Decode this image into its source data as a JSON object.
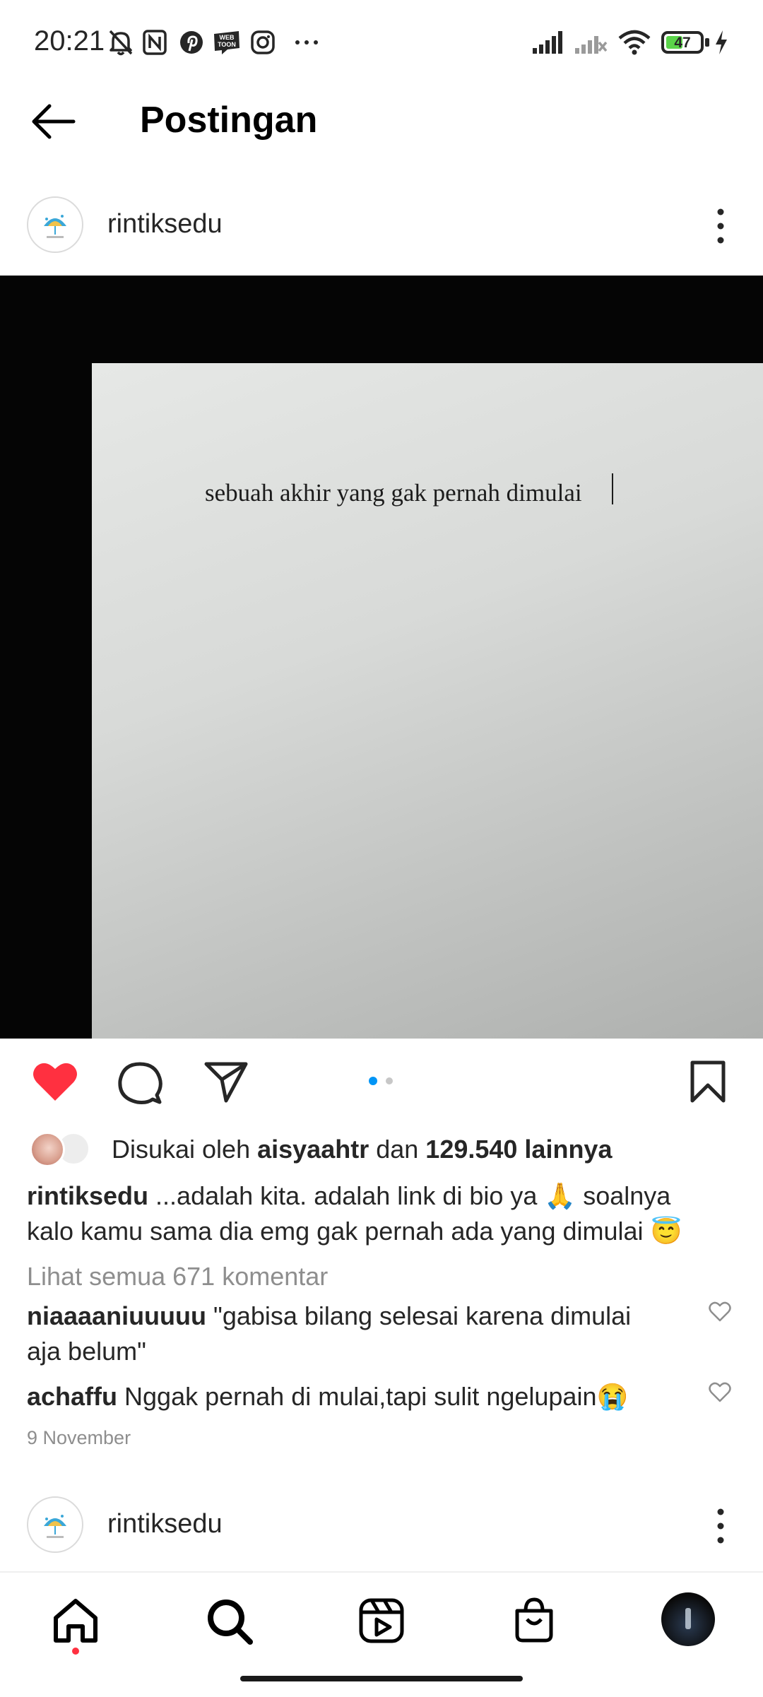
{
  "status_bar": {
    "time": "20:21",
    "icons": [
      "mute-bell-icon",
      "nfc-icon",
      "pinterest-icon",
      "webtoon-icon",
      "instagram-icon",
      "more-dots-icon",
      "signal-icon",
      "signal-off-icon",
      "wifi-icon",
      "battery-icon",
      "charging-icon"
    ],
    "webtoon_badge": "WEB TOON",
    "battery_level": "47",
    "battery_color": "#5bd44a"
  },
  "header": {
    "back_icon": "arrow-left-icon",
    "title": "Postingan"
  },
  "post": {
    "username": "rintiksedu",
    "image_text": "sebuah akhir yang gak pernah dimulai",
    "carousel": {
      "count": 2,
      "active": 1,
      "active_color": "#0095f6"
    },
    "liked": true,
    "like_color": "#ff3040",
    "likes_prefix": "Disukai oleh ",
    "likes_user": "aisyaahtr",
    "likes_middle": " dan ",
    "likes_count": "129.540 lainnya",
    "caption_user": "rintiksedu",
    "caption_line1": " ...adalah kita. adalah link di bio ya 🙏 soalnya",
    "caption_line2": "kalo kamu sama dia emg gak pernah ada yang dimulai 😇",
    "view_comments": "Lihat semua 671 komentar",
    "comments": [
      {
        "user": "niaaaaniuuuuu",
        "text_line1": " \"gabisa bilang selesai karena dimulai",
        "text_line2": "aja belum\""
      },
      {
        "user": "achaffu",
        "text_line1": " Nggak pernah di mulai,tapi sulit ngelupain😭"
      }
    ],
    "date": "9 November"
  },
  "next_post": {
    "username": "rintiksedu"
  },
  "bottom_nav": {
    "items": [
      "home-icon",
      "search-icon",
      "reels-icon",
      "shop-icon",
      "profile-avatar"
    ],
    "notification_dot_color": "#ff3040"
  }
}
